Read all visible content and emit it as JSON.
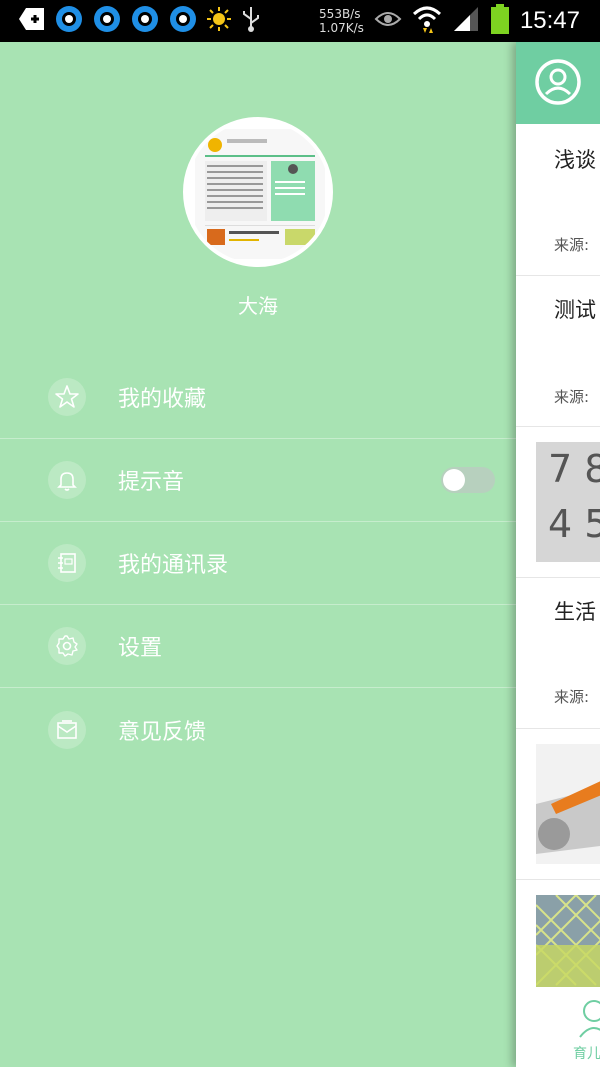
{
  "status_bar": {
    "speed_up": "553B/s",
    "speed_down": "1.07K/s",
    "time": "15:47",
    "icons": [
      "add-notification-icon",
      "qq-icon",
      "qq-icon",
      "qq-icon",
      "qq-icon",
      "sun-icon",
      "usb-icon",
      "eye-icon",
      "wifi-icon",
      "signal-icon",
      "battery-icon"
    ]
  },
  "drawer": {
    "username": "大海",
    "menu": [
      {
        "label": "我的收藏",
        "icon": "star-icon"
      },
      {
        "label": "提示音",
        "icon": "bell-icon",
        "toggle": "off"
      },
      {
        "label": "我的通讯录",
        "icon": "contacts-icon"
      },
      {
        "label": "设置",
        "icon": "gear-icon"
      },
      {
        "label": "意见反馈",
        "icon": "feedback-icon"
      }
    ]
  },
  "content": {
    "cards": [
      {
        "title": "浅谈",
        "source": "来源:"
      },
      {
        "title": "测试",
        "source": "来源:"
      },
      {
        "title": "",
        "source": ""
      },
      {
        "title": "生活",
        "source": "来源:"
      }
    ],
    "tab_label": "育儿"
  },
  "colors": {
    "drawer_bg": "#a8e3b3",
    "accent": "#6fcea2"
  }
}
